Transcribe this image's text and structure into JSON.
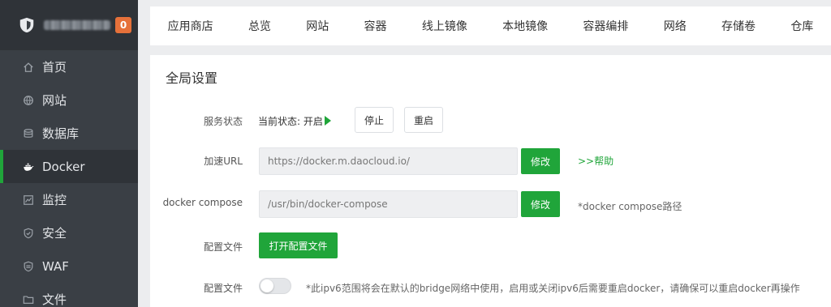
{
  "colors": {
    "accent": "#20a53a",
    "badge": "#e6713a",
    "sidebar": "#3a3f45"
  },
  "brand": {
    "badge_count": "0",
    "logo_icon": "shield-logo-icon"
  },
  "sidebar": {
    "items": [
      {
        "label": "首页",
        "icon": "home-icon"
      },
      {
        "label": "网站",
        "icon": "globe-icon"
      },
      {
        "label": "数据库",
        "icon": "database-icon"
      },
      {
        "label": "Docker",
        "icon": "docker-icon",
        "active": true
      },
      {
        "label": "监控",
        "icon": "monitor-icon"
      },
      {
        "label": "安全",
        "icon": "security-shield-icon"
      },
      {
        "label": "WAF",
        "icon": "waf-shield-icon"
      },
      {
        "label": "文件",
        "icon": "folder-icon"
      }
    ]
  },
  "tabs": [
    "应用商店",
    "总览",
    "网站",
    "容器",
    "线上镜像",
    "本地镜像",
    "容器编排",
    "网络",
    "存储卷",
    "仓库"
  ],
  "panel": {
    "title": "全局设置",
    "service": {
      "label": "服务状态",
      "status_text": "当前状态: 开启",
      "stop_label": "停止",
      "restart_label": "重启"
    },
    "mirror": {
      "label": "加速URL",
      "value": "https://docker.m.daocloud.io/",
      "button": "修改",
      "help": ">>帮助"
    },
    "compose": {
      "label": "docker compose",
      "value": "/usr/bin/docker-compose",
      "button": "修改",
      "hint": "*docker compose路径"
    },
    "config": {
      "label": "配置文件",
      "button": "打开配置文件"
    },
    "ipv6": {
      "label": "配置文件",
      "enabled": false,
      "hint": "*此ipv6范围将会在默认的bridge网络中使用，启用或关闭ipv6后需要重启docker，请确保可以重启docker再操作"
    }
  }
}
